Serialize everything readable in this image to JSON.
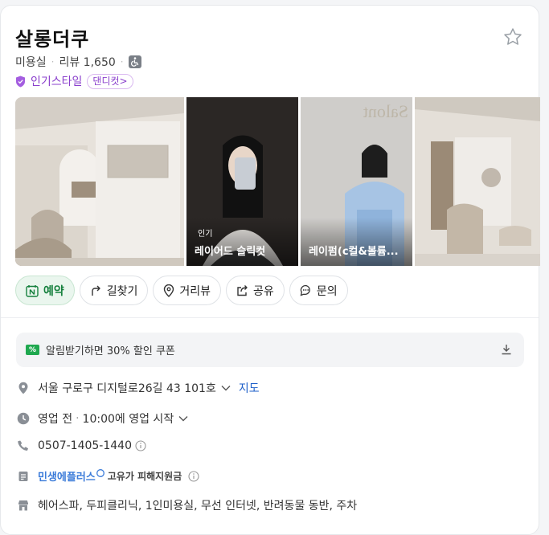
{
  "place": {
    "name": "살롱더쿠",
    "category": "미용실",
    "review_label": "리뷰 1,650",
    "style_label": "인기스타일",
    "style_tag": "댄디컷>"
  },
  "photos": [
    {
      "badge": "",
      "caption": ""
    },
    {
      "badge": "인기",
      "caption": "레이어드 슬릭컷"
    },
    {
      "badge": "",
      "caption": "레이펌(c컬&볼륨..."
    },
    {
      "badge": "",
      "caption": ""
    }
  ],
  "actions": {
    "reserve": "예약",
    "directions": "길찾기",
    "streetview": "거리뷰",
    "share": "공유",
    "inquiry": "문의"
  },
  "coupon": {
    "icon_text": "%",
    "text": "알림받기하면 30% 할인 쿠폰"
  },
  "info": {
    "address": "서울 구로구 디지털로26길 43 101호",
    "map_link": "지도",
    "hours_status": "영업 전",
    "hours_text": "10:00에 영업 시작",
    "phone": "0507-1405-1440",
    "promo_brand": "민생에플러스",
    "promo_text": "고유가 피해지원금",
    "amenities": "헤어스파, 두피클리닉, 1인미용실, 무선 인터넷, 반려동물 동반, 주차"
  },
  "colors": {
    "reserve_green": "#15803d",
    "style_purple": "#8a3fcc",
    "link_blue": "#1e5fc9"
  }
}
